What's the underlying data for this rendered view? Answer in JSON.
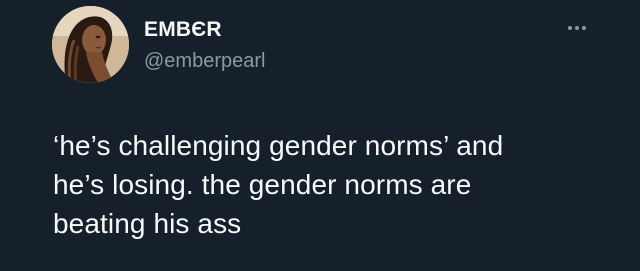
{
  "tweet": {
    "author": {
      "display_name": "EMBЄR",
      "handle": "@emberpearl",
      "avatar": "avatar-photo"
    },
    "more_icon": "more-horizontal-icon",
    "text": "‘he’s challenging gender norms’ and\nhe’s losing. the gender norms are\nbeating his ass"
  },
  "colors": {
    "background": "#15202b",
    "primary_text": "#f7f9f9",
    "secondary_text": "#8b98a5"
  }
}
